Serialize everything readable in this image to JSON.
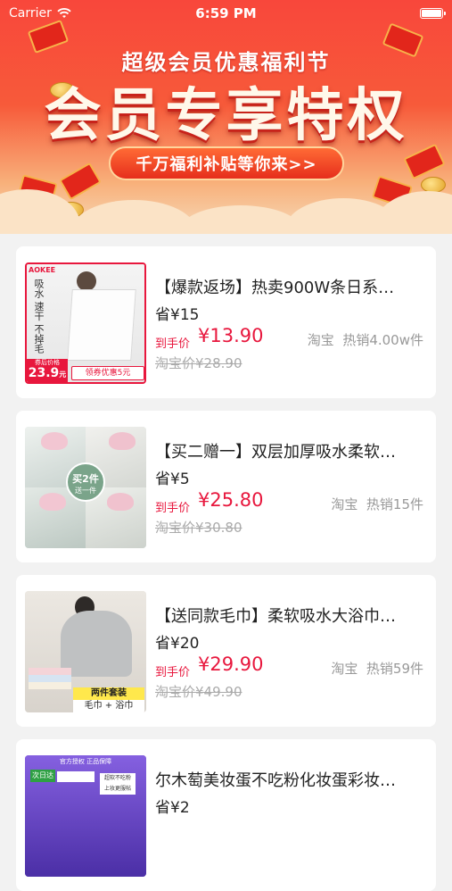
{
  "status_bar": {
    "carrier": "Carrier",
    "time": "6:59 PM"
  },
  "banner": {
    "subtitle": "超级会员优惠福利节",
    "title": "会员专享特权",
    "cta": "千万福利补贴等你来>>"
  },
  "products": [
    {
      "title": "【爆款返场】热卖900W条日系…",
      "save": "省¥15",
      "price_label": "到手价",
      "price": "¥13.90",
      "shop": "淘宝",
      "sales": "热销4.00w件",
      "original": "淘宝价¥28.90",
      "thumb": {
        "brand": "AOKEE",
        "vertical_text": "吸水 速干 不掉毛",
        "promo_label": "券后价格",
        "promo_price": "23.9",
        "promo_unit": "元",
        "coupon": "领券优惠5元"
      }
    },
    {
      "title": "【买二赠一】双层加厚吸水柔软…",
      "save": "省¥5",
      "price_label": "到手价",
      "price": "¥25.80",
      "shop": "淘宝",
      "sales": "热销15件",
      "original": "淘宝价¥30.80",
      "thumb": {
        "badge_top": "买2件",
        "badge_bottom": "送一件"
      }
    },
    {
      "title": "【送同款毛巾】柔软吸水大浴巾…",
      "save": "省¥20",
      "price_label": "到手价",
      "price": "¥29.90",
      "shop": "淘宝",
      "sales": "热销59件",
      "original": "淘宝价¥49.90",
      "thumb": {
        "tag_line1": "两件套装",
        "tag_line2": "毛巾 + 浴巾"
      }
    },
    {
      "title": "尔木萄美妆蛋不吃粉化妆蛋彩妆…",
      "save": "省¥2",
      "thumb": {
        "header": "官方授权 正品保障",
        "brand": "次日达",
        "sticker_line1": "超软不吃粉",
        "sticker_line2": "上妆更服帖"
      }
    }
  ]
}
